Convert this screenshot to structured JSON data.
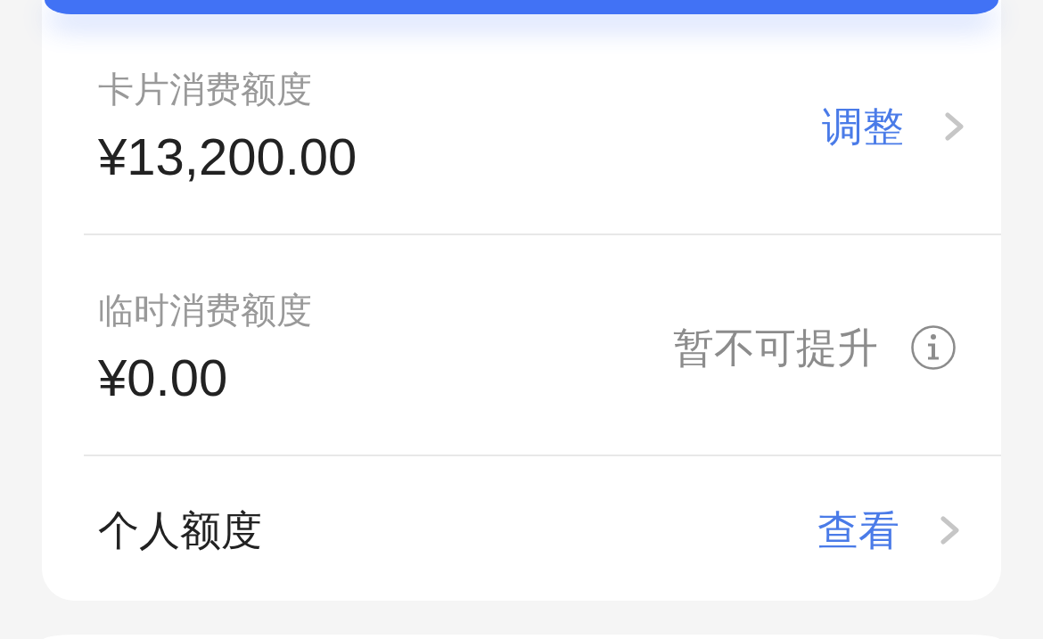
{
  "limits": [
    {
      "kind": "amount",
      "label": "卡片消费额度",
      "amount": "¥13,200.00",
      "action": "调整"
    },
    {
      "kind": "amount",
      "label": "临时消费额度",
      "amount": "¥0.00",
      "note": "暂不可提升"
    },
    {
      "kind": "entry",
      "label": "个人额度",
      "action": "查看"
    }
  ]
}
